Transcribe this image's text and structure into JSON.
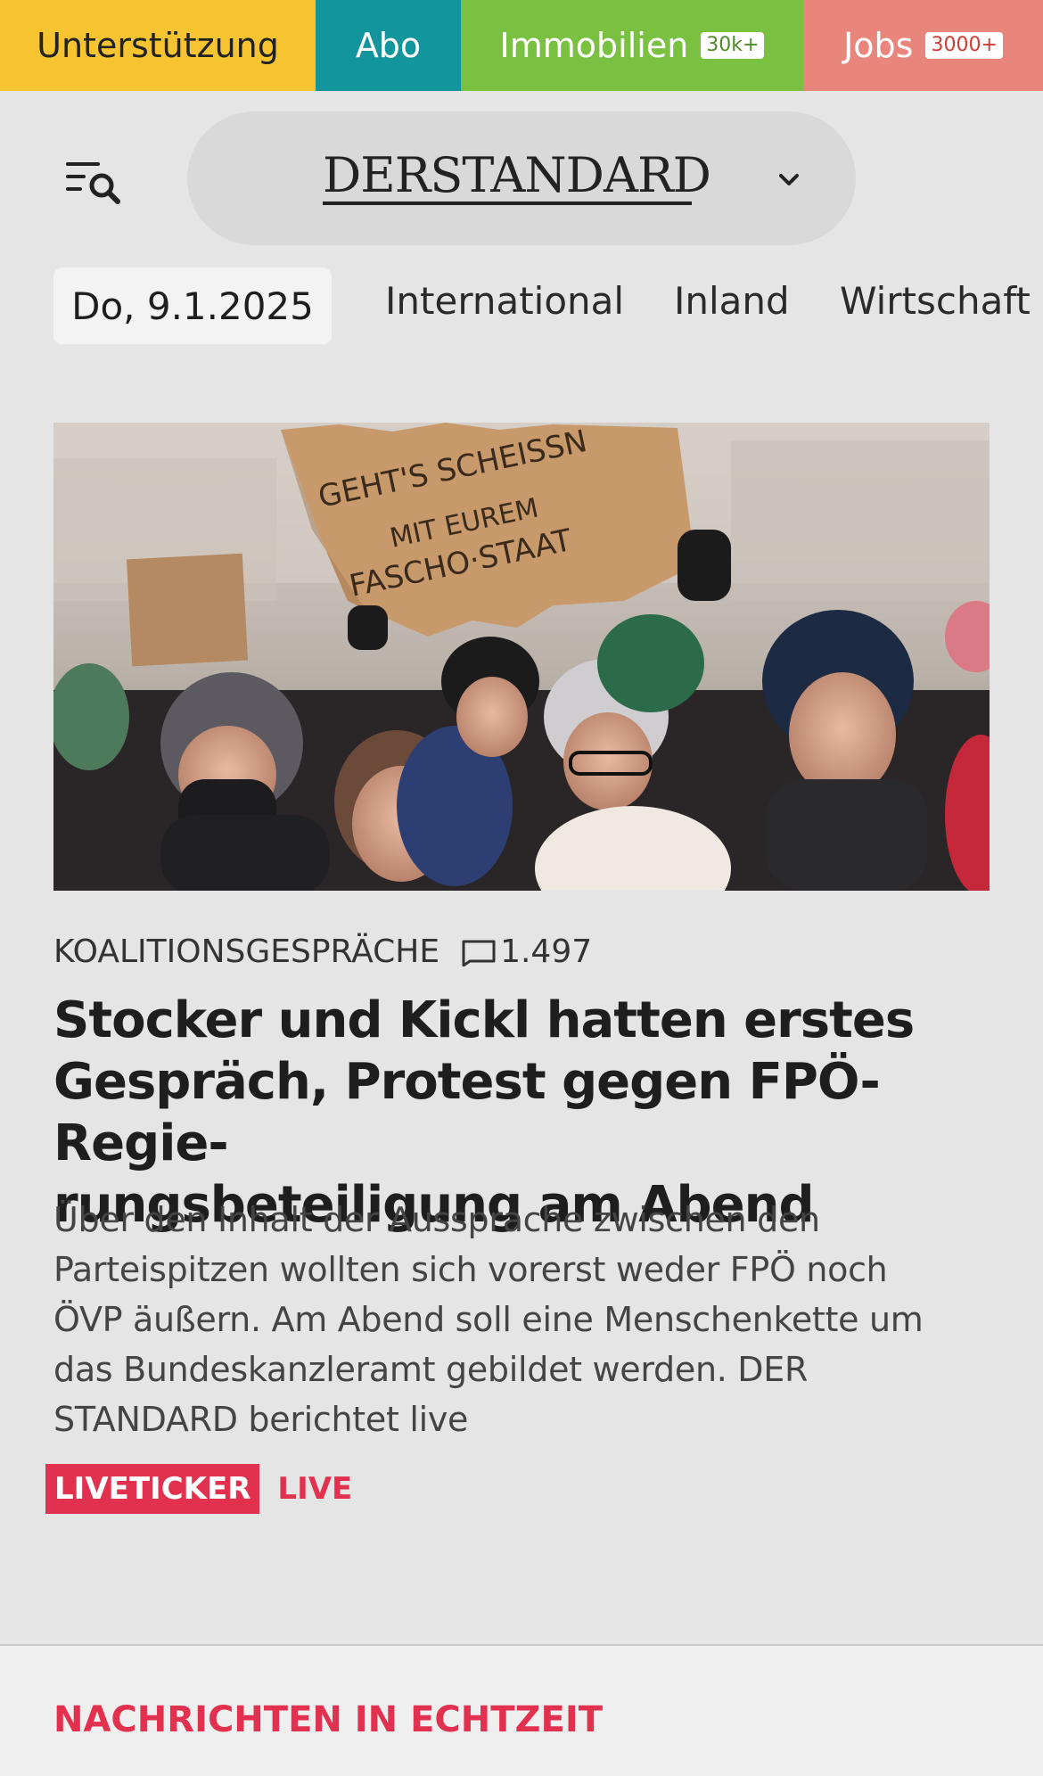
{
  "topbar": {
    "support": "Unterstützung",
    "abo": "Abo",
    "immobilien": "Immobilien",
    "immobilien_badge": "30k+",
    "jobs": "Jobs",
    "jobs_badge": "3000+"
  },
  "header": {
    "logo": "DERSTANDARD",
    "menu_icon": "menu-search-icon",
    "dropdown_icon": "chevron-down-icon"
  },
  "nav": {
    "date": "Do, 9.1.2025",
    "items": [
      "International",
      "Inland",
      "Wirtschaft"
    ]
  },
  "article": {
    "image_alt_sign": "GEHT'S SCHEISSN MIT EUREM FASCHO-STAAT",
    "kicker": "KOALITIONSGESPRÄCHE",
    "comments": "1.497",
    "headline": "Stocker und Kickl hatten erstes Gespräch, Protest gegen FPÖ-Regie- rungsbeteiligung am Abend",
    "headline_lines": [
      "Stocker und Kickl hatten erstes",
      "Gespräch, Protest gegen FPÖ-Regie-",
      "rungsbeteiligung am Abend"
    ],
    "teaser_lines": [
      "Über den Inhalt der Aussprache zwischen den",
      "Parteispitzen wollten sich vorerst weder FPÖ noch",
      "ÖVP äußern. Am Abend soll eine Menschenkette um",
      "das Bundeskanzleramt gebildet werden. DER",
      "STANDARD berichtet live"
    ],
    "badge_liveticker": "LIVETICKER",
    "badge_live": "LIVE"
  },
  "section": {
    "title": "NACHRICHTEN IN ECHTZEIT"
  },
  "colors": {
    "support": "#f7c431",
    "abo": "#12959c",
    "immobilien": "#7ac142",
    "jobs": "#e9867c",
    "accent_red": "#e2304f"
  }
}
